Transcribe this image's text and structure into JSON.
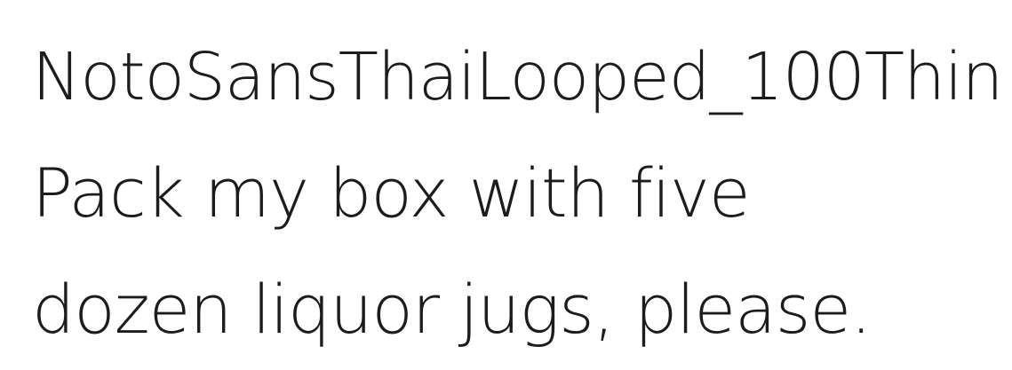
{
  "font_sample": {
    "font_name": "NotoSansThaiLooped_100Thin",
    "lines": [
      "Pack my box with five",
      "dozen liquor jugs, please."
    ],
    "text_color": "#1c1c1c",
    "background_color": "#ffffff"
  }
}
